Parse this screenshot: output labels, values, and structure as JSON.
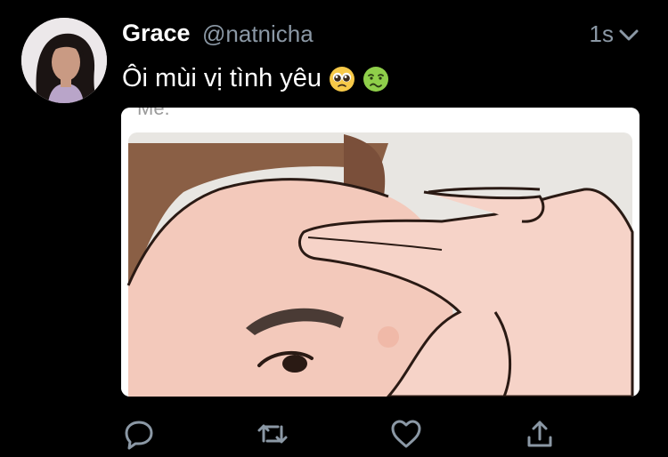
{
  "tweet": {
    "author_name": "Grace",
    "author_handle": "@natnicha",
    "time": "1s",
    "text": "Ôi mùi vị tình yêu",
    "emojis": [
      "pleading-face-emoji",
      "nauseated-face-emoji"
    ],
    "media_caption": "Me:"
  },
  "icons": {
    "caret": "chevron-down-icon",
    "reply": "reply-icon",
    "retweet": "retweet-icon",
    "like": "heart-icon",
    "share": "share-icon"
  },
  "colors": {
    "background": "#000000",
    "primary_text": "#ffffff",
    "secondary_text": "#8b98a5",
    "icon": "#8b98a5"
  }
}
